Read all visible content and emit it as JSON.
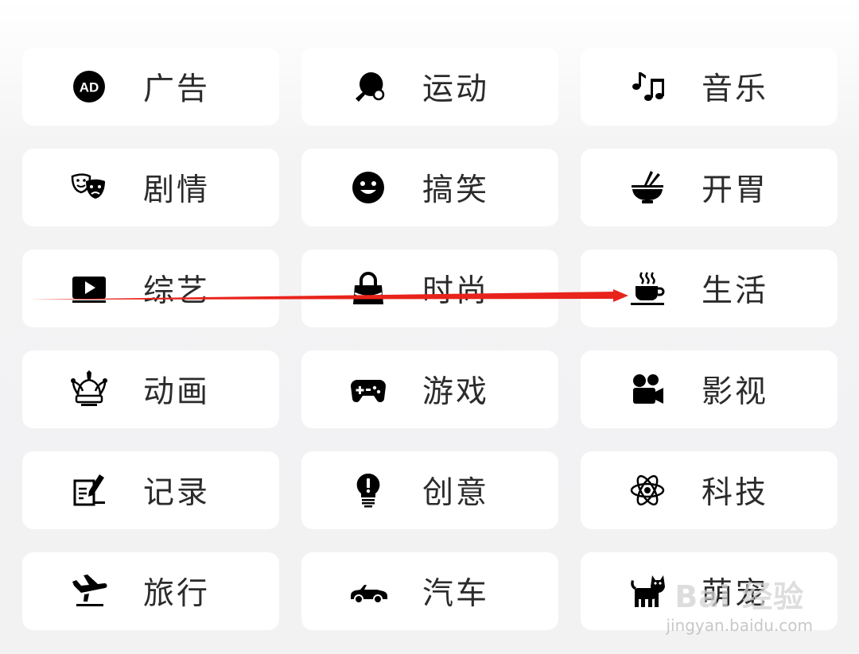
{
  "categories": [
    {
      "label": "广告",
      "icon": "ad-icon"
    },
    {
      "label": "运动",
      "icon": "ping-pong-icon"
    },
    {
      "label": "音乐",
      "icon": "music-notes-icon"
    },
    {
      "label": "剧情",
      "icon": "theater-masks-icon"
    },
    {
      "label": "搞笑",
      "icon": "smiley-face-icon"
    },
    {
      "label": "开胃",
      "icon": "noodle-bowl-icon"
    },
    {
      "label": "综艺",
      "icon": "video-play-icon"
    },
    {
      "label": "时尚",
      "icon": "handbag-icon"
    },
    {
      "label": "生活",
      "icon": "hot-coffee-cup-icon"
    },
    {
      "label": "动画",
      "icon": "jester-hat-icon"
    },
    {
      "label": "游戏",
      "icon": "gamepad-icon"
    },
    {
      "label": "影视",
      "icon": "movie-camera-icon"
    },
    {
      "label": "记录",
      "icon": "note-pen-icon"
    },
    {
      "label": "创意",
      "icon": "lightbulb-icon"
    },
    {
      "label": "科技",
      "icon": "atom-icon"
    },
    {
      "label": "旅行",
      "icon": "airplane-landing-icon"
    },
    {
      "label": "汽车",
      "icon": "convertible-car-icon"
    },
    {
      "label": "萌宠",
      "icon": "cat-icon"
    }
  ],
  "watermark": {
    "brand": "Bai 经验",
    "url": "jingyan.baidu.com"
  },
  "annotation_color": "#e8231b"
}
